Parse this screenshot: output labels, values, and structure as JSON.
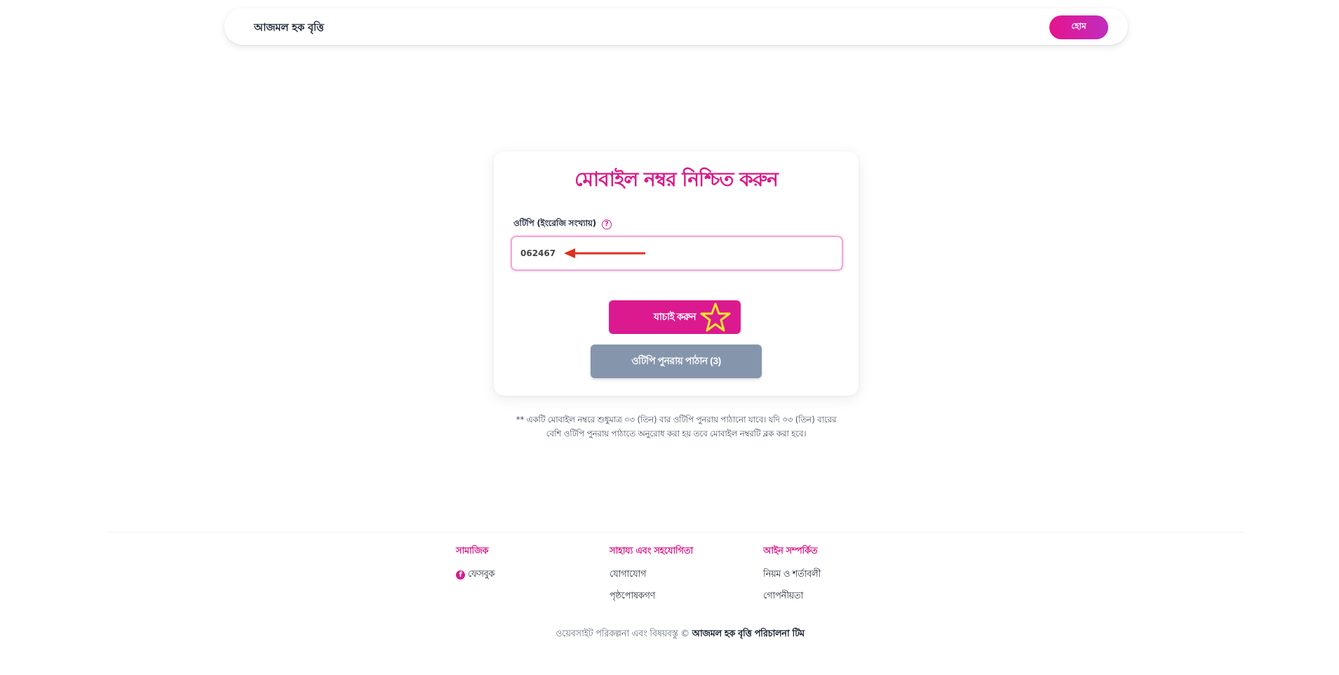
{
  "navbar": {
    "brand": "আজমল হক বৃত্তি",
    "home_label": "হোম"
  },
  "form": {
    "title": "মোবাইল নম্বর নিশ্চিত করুন",
    "otp_label": "ওটিপি (ইংরেজি সংখ্যায়)",
    "help_icon": "?",
    "otp_value": "062467",
    "verify_label": "যাচাই করুন",
    "resend_label": "ওটিপি পুনরায় পাঠান (3)"
  },
  "note": "** একটি মোবাইল নম্বরে শুধুমাত্র ০৩ (তিন) বার ওটিপি পুনরায় পাঠানো যাবে। যদি ০৩ (তিন) বারের বেশি ওটিপি পুনরায় পাঠাতে অনুরোধ করা হয় তবে মোবাইল নম্বরটি ব্লক করা হবে।",
  "footer": {
    "social": {
      "heading": "সামাজিক",
      "links": [
        "ফেসবুক"
      ]
    },
    "help": {
      "heading": "সাহায্য এবং সহযোগিতা",
      "links": [
        "যোগাযোগ",
        "পৃষ্ঠপোষকগণ"
      ]
    },
    "legal": {
      "heading": "আইন সম্পর্কিত",
      "links": [
        "নিয়ম ও শর্তাবলী",
        "গোপনীয়তা"
      ]
    },
    "copyright_prefix": "ওয়েবসাইট পরিকল্পনা এবং বিষয়বস্তু ©",
    "copyright_team": "আজমল হক বৃত্তি পরিচালনা টিম"
  },
  "colors": {
    "accent": "#d81b8a",
    "resend_bg": "#8595ab",
    "input_border": "#f0a6d6"
  },
  "icons": {
    "help": "question-circle-icon",
    "facebook": "facebook-icon"
  }
}
